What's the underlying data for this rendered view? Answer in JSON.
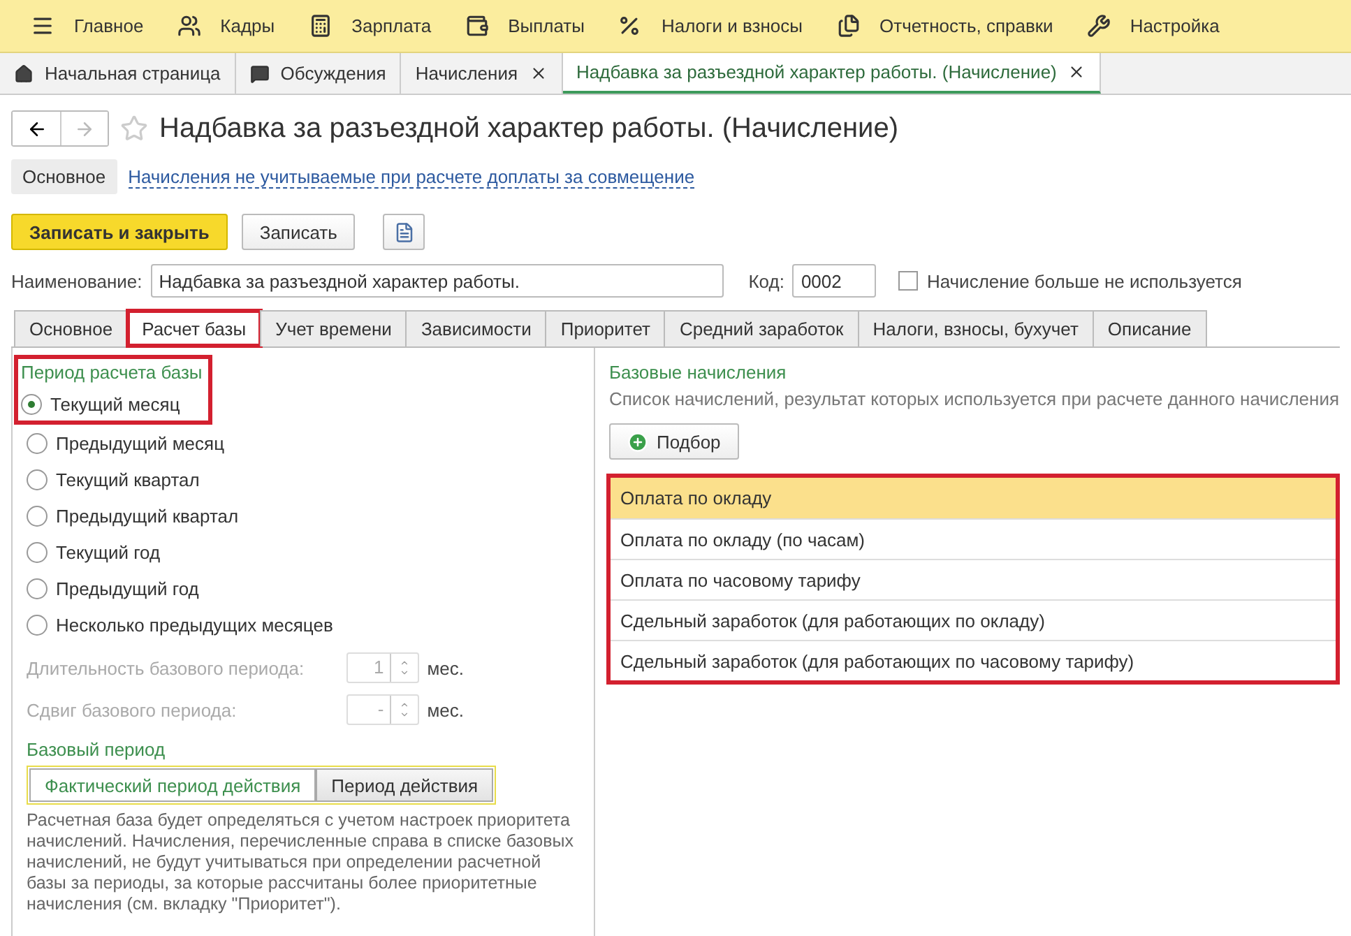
{
  "main_menu": [
    {
      "label": "Главное"
    },
    {
      "label": "Кадры"
    },
    {
      "label": "Зарплата"
    },
    {
      "label": "Выплаты"
    },
    {
      "label": "Налоги и взносы"
    },
    {
      "label": "Отчетность, справки"
    },
    {
      "label": "Настройка"
    }
  ],
  "open_tabs": [
    {
      "label": "Начальная страница",
      "selected": false,
      "closable": false
    },
    {
      "label": "Обсуждения",
      "selected": false,
      "closable": false
    },
    {
      "label": "Начисления",
      "selected": false,
      "closable": true
    },
    {
      "label": "Надбавка за разъездной характер работы. (Начисление)",
      "selected": true,
      "closable": true
    }
  ],
  "form": {
    "title": "Надбавка за разъездной характер работы. (Начисление)",
    "favorite": false,
    "nav_links": [
      {
        "label": "Основное",
        "selected": true
      },
      {
        "label": "Начисления не учитываемые при расчете доплаты за совмещение",
        "selected": false
      }
    ],
    "buttons": [
      {
        "label": "Записать и закрыть",
        "kind": "primary"
      },
      {
        "label": "Записать",
        "kind": "normal"
      }
    ],
    "name_label": "Наименование:",
    "name_value": "Надбавка за разъездной характер работы.",
    "code_label": "Код:",
    "code_value": "0002",
    "unused": {
      "label": "Начисление больше не используется",
      "checked": false
    },
    "tabs": [
      {
        "label": "Основное",
        "selected": false,
        "highlighted": false
      },
      {
        "label": "Расчет базы",
        "selected": true,
        "highlighted": true
      },
      {
        "label": "Учет времени",
        "selected": false,
        "highlighted": false
      },
      {
        "label": "Зависимости",
        "selected": false,
        "highlighted": false
      },
      {
        "label": "Приоритет",
        "selected": false,
        "highlighted": false
      },
      {
        "label": "Средний заработок",
        "selected": false,
        "highlighted": false
      },
      {
        "label": "Налоги, взносы, бухучет",
        "selected": false,
        "highlighted": false
      },
      {
        "label": "Описание",
        "selected": false,
        "highlighted": false
      }
    ],
    "period": {
      "title": "Период расчета базы",
      "highlighted": true,
      "options": [
        {
          "label": "Текущий месяц",
          "selected": true
        },
        {
          "label": "Предыдущий месяц",
          "selected": false
        },
        {
          "label": "Текущий квартал",
          "selected": false
        },
        {
          "label": "Предыдущий квартал",
          "selected": false
        },
        {
          "label": "Текущий год",
          "selected": false
        },
        {
          "label": "Предыдущий год",
          "selected": false
        },
        {
          "label": "Несколько предыдущих месяцев",
          "selected": false
        }
      ],
      "fields": [
        {
          "label": "Длительность базового периода:",
          "value": "1",
          "unit": "мес.",
          "disabled": true
        },
        {
          "label": "Сдвиг базового периода:",
          "value": "-",
          "unit": "мес.",
          "disabled": true
        }
      ]
    },
    "base_period": {
      "title": "Базовый период",
      "options": [
        {
          "label": "Фактический период действия",
          "selected": true
        },
        {
          "label": "Период действия",
          "selected": false
        }
      ],
      "note": "Расчетная база будет определяться с учетом настроек приоритета начислений. Начисления, перечисленные справа в списке базовых начислений, не будут учитываться при определении расчетной базы за периоды, за которые рассчитаны более приоритетные начисления (см. вкладку \"Приоритет\")."
    },
    "base_accruals": {
      "title": "Базовые начисления",
      "subtitle": "Список начислений, результат которых используется при расчете данного начисления",
      "pick_button": "Подбор",
      "highlighted": true,
      "rows": [
        {
          "label": "Оплата по окладу",
          "selected": true
        },
        {
          "label": "Оплата по окладу (по часам)",
          "selected": false
        },
        {
          "label": "Оплата по часовому тарифу",
          "selected": false
        },
        {
          "label": "Сдельный заработок (для работающих по окладу)",
          "selected": false
        },
        {
          "label": "Сдельный заработок (для работающих по часовому тарифу)",
          "selected": false
        }
      ]
    }
  }
}
